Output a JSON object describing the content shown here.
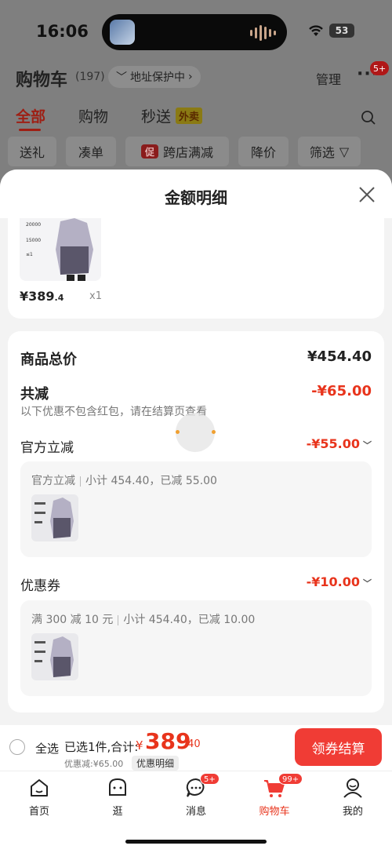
{
  "status": {
    "time": "16:06",
    "battery": "53"
  },
  "header": {
    "title": "购物车",
    "count": "(197)",
    "address_pill": "地址保护中",
    "manage": "管理",
    "more_badge": "5+"
  },
  "tabs": [
    {
      "label": "全部",
      "active": true
    },
    {
      "label": "购物"
    },
    {
      "label": "秒送"
    }
  ],
  "tab_badge": "外卖",
  "chips": [
    "送礼",
    "凑单",
    "跨店满减",
    "降价",
    "筛选"
  ],
  "chip_promo_icon": "促",
  "sheet": {
    "title": "金额明细",
    "product": {
      "price_int": "¥389",
      "price_dec": ".4",
      "qty": "x1"
    },
    "total_label": "商品总价",
    "total_value": "¥454.40",
    "discount_label": "共减",
    "discount_value": "-¥65.00",
    "note": "以下优惠不包含红包，请在结算页查看",
    "official_label": "官方立减",
    "official_value": "-¥55.00",
    "official_detail_a": "官方立减",
    "official_detail_b": "小计 454.40，已减 55.00",
    "coupon_label": "优惠券",
    "coupon_value": "-¥10.00",
    "coupon_detail_a": "满 300 减 10 元",
    "coupon_detail_b": "小计 454.40，已减 10.00"
  },
  "bottom": {
    "select_all": "全选",
    "selected": "已选1件,合计:",
    "currency": "¥",
    "total_int": "389",
    "total_dec": ".40",
    "discount": "优惠减:¥65.00",
    "detail": "优惠明细",
    "checkout": "领券结算"
  },
  "nav": [
    {
      "label": "首页",
      "icon": "home-icon"
    },
    {
      "label": "逛",
      "icon": "browse-icon"
    },
    {
      "label": "消息",
      "icon": "message-icon",
      "badge": "5+"
    },
    {
      "label": "购物车",
      "icon": "cart-icon",
      "badge": "99+",
      "active": true
    },
    {
      "label": "我的",
      "icon": "profile-icon"
    }
  ],
  "colors": {
    "accent": "#e8341c",
    "checkout": "#f03c35"
  }
}
